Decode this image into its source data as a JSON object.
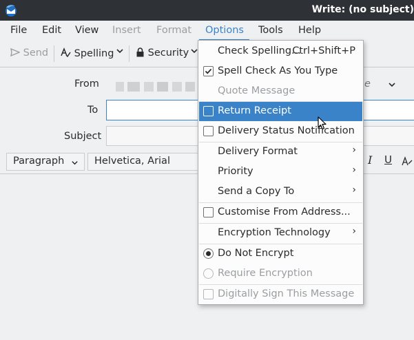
{
  "window": {
    "title": "Write: (no subject)",
    "app_icon": "thunderbird-icon"
  },
  "menubar": {
    "items": [
      {
        "label": "File",
        "state": "normal"
      },
      {
        "label": "Edit",
        "state": "normal"
      },
      {
        "label": "View",
        "state": "normal"
      },
      {
        "label": "Insert",
        "state": "disabled"
      },
      {
        "label": "Format",
        "state": "disabled"
      },
      {
        "label": "Options",
        "state": "open"
      },
      {
        "label": "Tools",
        "state": "normal"
      },
      {
        "label": "Help",
        "state": "normal"
      }
    ]
  },
  "toolbar": {
    "send_label": "Send",
    "spelling_label": "Spelling",
    "security_label": "Security"
  },
  "compose": {
    "from_label": "From",
    "to_label": "To",
    "subject_label": "Subject",
    "to_value": "",
    "subject_value": ""
  },
  "format_bar": {
    "paragraph": "Paragraph",
    "font": "Helvetica, Arial"
  },
  "options_menu": {
    "items": [
      {
        "label": "Check Spelling...",
        "shortcut": "Ctrl+Shift+P",
        "kind": "plain",
        "state": "normal"
      },
      {
        "label": "Spell Check As You Type",
        "kind": "check",
        "checked": true,
        "state": "normal"
      },
      {
        "label": "Quote Message",
        "kind": "plain",
        "state": "disabled"
      },
      {
        "label": "Return Receipt",
        "kind": "check",
        "checked": false,
        "state": "highlighted"
      },
      {
        "label": "Delivery Status Notification",
        "kind": "check",
        "checked": false,
        "state": "normal"
      },
      {
        "label": "Delivery Format",
        "kind": "submenu",
        "state": "normal"
      },
      {
        "label": "Priority",
        "kind": "submenu",
        "state": "normal"
      },
      {
        "label": "Send a Copy To",
        "kind": "submenu",
        "state": "normal"
      },
      {
        "label": "Customise From Address...",
        "kind": "check",
        "checked": false,
        "state": "normal"
      },
      {
        "label": "Encryption Technology",
        "kind": "submenu",
        "state": "normal"
      },
      {
        "label": "Do Not Encrypt",
        "kind": "radio",
        "selected": true,
        "state": "normal"
      },
      {
        "label": "Require Encryption",
        "kind": "radio",
        "selected": false,
        "state": "disabled"
      },
      {
        "label": "Digitally Sign This Message",
        "kind": "check",
        "checked": false,
        "state": "disabled"
      }
    ]
  },
  "colors": {
    "accent": "#3a83c8",
    "titlebar": "#2e3136",
    "chrome": "#eff0f1",
    "disabled_text": "#9b9ea1"
  }
}
